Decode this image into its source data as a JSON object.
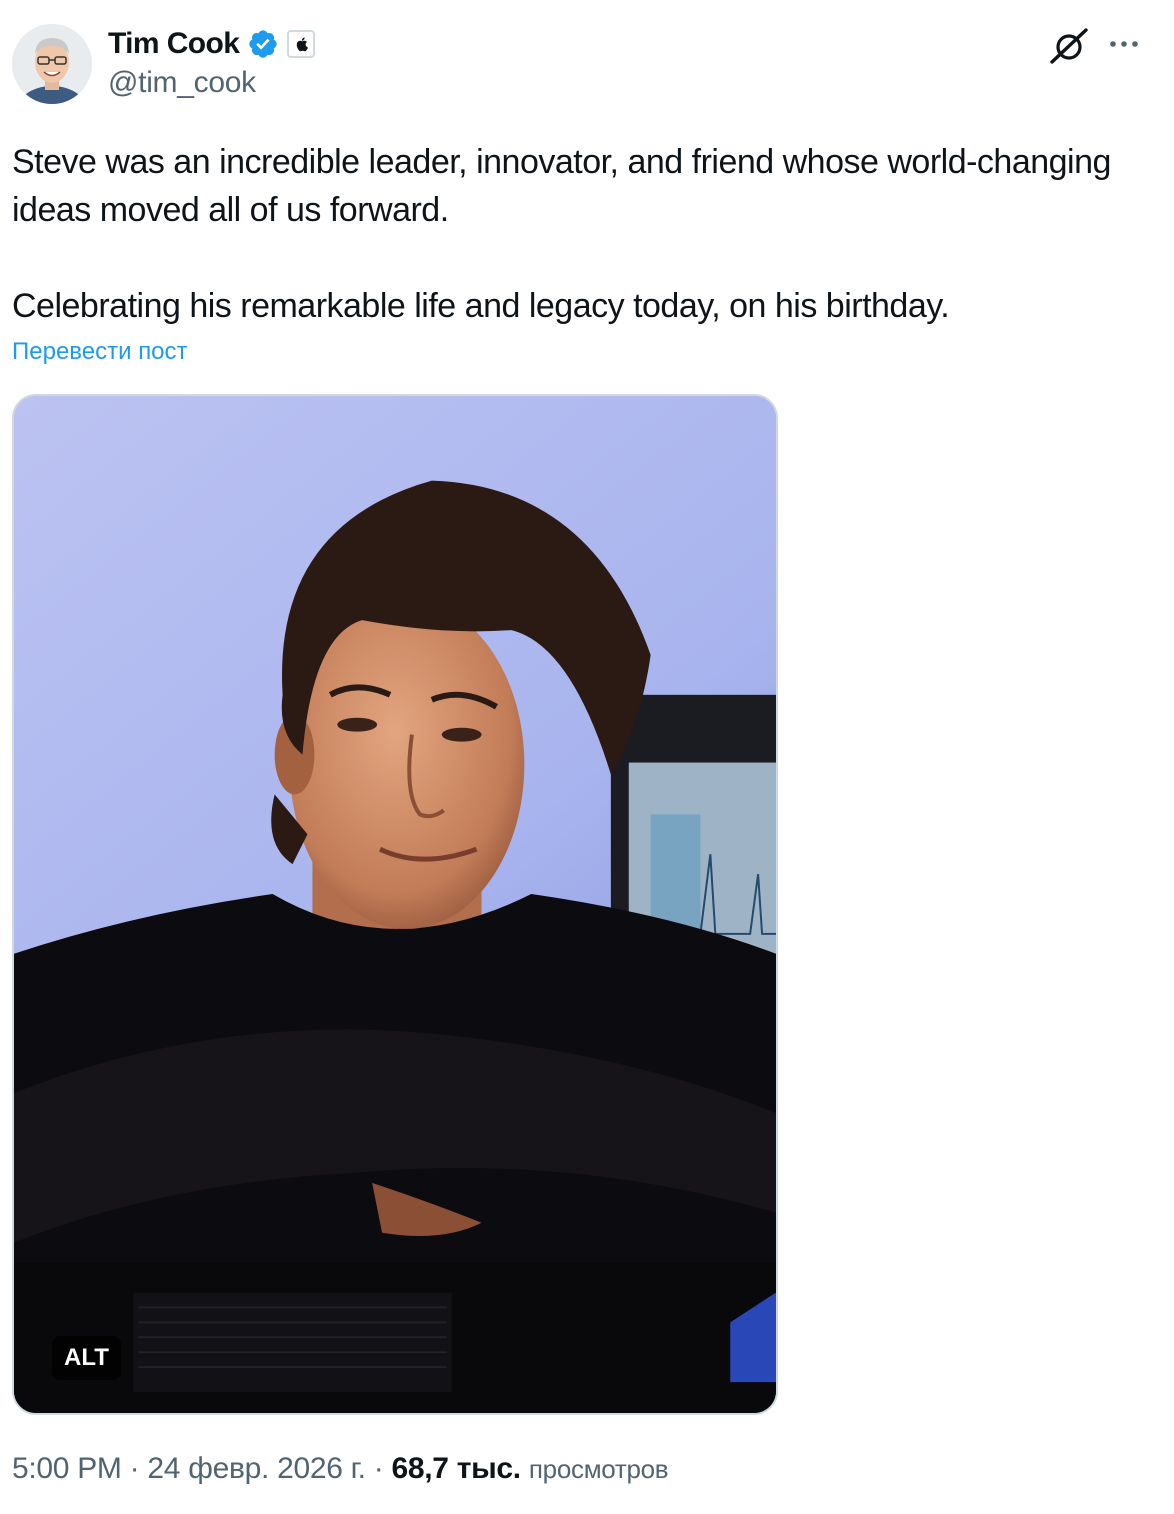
{
  "author": {
    "display_name": "Tim Cook",
    "handle": "@tim_cook",
    "verified_icon": "verified-badge-icon",
    "affiliate_icon": "apple-logo-icon"
  },
  "actions": {
    "grok_icon": "grok-icon",
    "more_icon": "more-options-icon"
  },
  "post": {
    "paragraphs": [
      "Steve was an incredible leader, innovator, and friend whose world-changing ideas moved all of us forward.",
      "Celebrating his remarkable life and legacy today, on his birthday."
    ],
    "translate_label": "Перевести пост"
  },
  "media": {
    "alt_label": "ALT"
  },
  "meta": {
    "time": "5:00 PM",
    "separator": "·",
    "date": "24 февр. 2026 г.",
    "views_count": "68,7 тыс.",
    "views_label": "просмотров"
  },
  "colors": {
    "link": "#1d9bf0",
    "secondary_text": "#536471",
    "primary_text": "#0f1419",
    "verified": "#1d9bf0"
  }
}
